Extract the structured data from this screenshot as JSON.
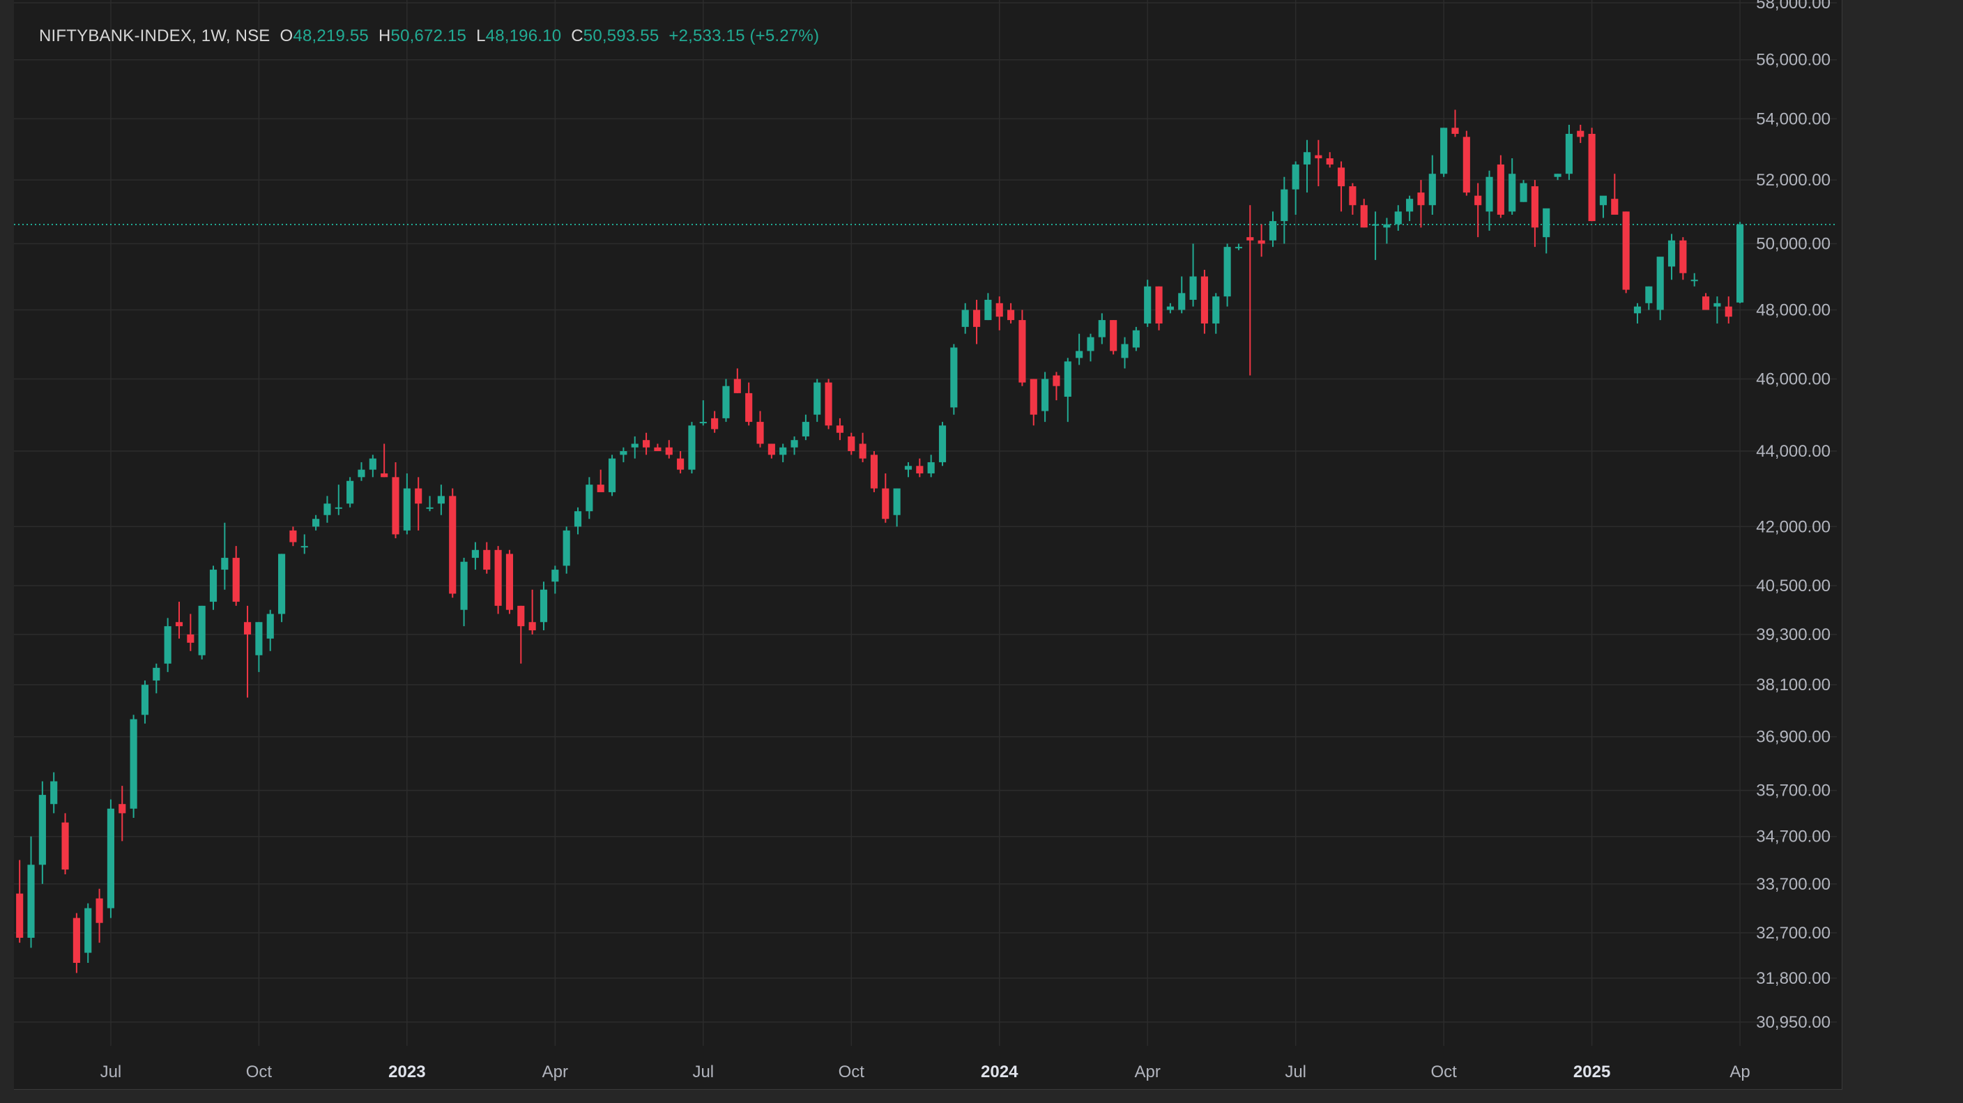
{
  "legend": {
    "symbol": "NIFTYBANK-INDEX, 1W, NSE",
    "o_label": "O",
    "o_value": "48,219.55",
    "h_label": "H",
    "h_value": "50,672.15",
    "l_label": "L",
    "l_value": "48,196.10",
    "c_label": "C",
    "c_value": "50,593.55",
    "change": "+2,533.15 (+5.27%)"
  },
  "colors": {
    "up": "#22ab94",
    "down": "#f23645",
    "grid": "#2c2c2c",
    "text": "#b2b5be",
    "background": "#1c1c1c",
    "last_price_line": "#22ab94"
  },
  "chart_data": {
    "type": "candlestick",
    "interval": "1W",
    "y_axis": {
      "scale": "log",
      "range": [
        30500,
        58100
      ],
      "tick_labels": [
        "58,000.00",
        "56,000.00",
        "54,000.00",
        "52,000.00",
        "50,000.00",
        "48,000.00",
        "46,000.00",
        "44,000.00",
        "42,000.00",
        "40,500.00",
        "39,300.00",
        "38,100.00",
        "36,900.00",
        "35,700.00",
        "34,700.00",
        "33,700.00",
        "32,700.00",
        "31,800.00",
        "30,950.00"
      ],
      "tick_values": [
        58000,
        56000,
        54000,
        52000,
        50000,
        48000,
        46000,
        44000,
        42000,
        40500,
        39300,
        38100,
        36900,
        35700,
        34700,
        33700,
        32700,
        31800,
        30950
      ]
    },
    "x_axis": {
      "tick_labels": [
        "Jul",
        "Oct",
        "2023",
        "Apr",
        "Jul",
        "Oct",
        "2024",
        "Apr",
        "Jul",
        "Oct",
        "2025",
        "Ap"
      ],
      "tick_bold": [
        false,
        false,
        true,
        false,
        false,
        false,
        true,
        false,
        false,
        false,
        true,
        false
      ],
      "tick_bar_index": [
        8,
        21,
        34,
        47,
        60,
        73,
        86,
        99,
        112,
        125,
        138,
        151
      ]
    },
    "grid": true,
    "last_price": 50593.55,
    "candles": [
      [
        33500,
        34200,
        32500,
        32600
      ],
      [
        32600,
        34700,
        32400,
        34100
      ],
      [
        34100,
        35900,
        33700,
        35600
      ],
      [
        35400,
        36100,
        35200,
        35900
      ],
      [
        35000,
        35200,
        33900,
        34000
      ],
      [
        33000,
        33100,
        31900,
        32100
      ],
      [
        32300,
        33300,
        32100,
        33200
      ],
      [
        33400,
        33600,
        32500,
        32900
      ],
      [
        33200,
        35500,
        33000,
        35300
      ],
      [
        35400,
        35800,
        34600,
        35200
      ],
      [
        35300,
        37400,
        35100,
        37300
      ],
      [
        37400,
        38200,
        37200,
        38100
      ],
      [
        38200,
        38600,
        37900,
        38500
      ],
      [
        38600,
        39700,
        38400,
        39500
      ],
      [
        39600,
        40100,
        39200,
        39500
      ],
      [
        39300,
        39800,
        38900,
        39100
      ],
      [
        38800,
        40000,
        38700,
        40000
      ],
      [
        40100,
        41000,
        39900,
        40900
      ],
      [
        40900,
        42100,
        40400,
        41200
      ],
      [
        41200,
        41500,
        40000,
        40100
      ],
      [
        39600,
        40000,
        37800,
        39300
      ],
      [
        38800,
        39600,
        38400,
        39600
      ],
      [
        39200,
        39900,
        38900,
        39800
      ],
      [
        39800,
        41300,
        39600,
        41300
      ],
      [
        41900,
        42000,
        41500,
        41600
      ],
      [
        41500,
        41800,
        41300,
        41500
      ],
      [
        42000,
        42300,
        41900,
        42200
      ],
      [
        42300,
        42800,
        42100,
        42600
      ],
      [
        42500,
        43100,
        42300,
        42500
      ],
      [
        42600,
        43300,
        42500,
        43200
      ],
      [
        43300,
        43700,
        43200,
        43500
      ],
      [
        43500,
        43900,
        43300,
        43800
      ],
      [
        43400,
        44200,
        43300,
        43300
      ],
      [
        43300,
        43700,
        41700,
        41800
      ],
      [
        41900,
        43400,
        41800,
        43000
      ],
      [
        43000,
        43300,
        41900,
        42600
      ],
      [
        42500,
        42800,
        42400,
        42500
      ],
      [
        42600,
        43100,
        42300,
        42800
      ],
      [
        42800,
        43000,
        40200,
        40300
      ],
      [
        39900,
        41200,
        39500,
        41100
      ],
      [
        41200,
        41600,
        40900,
        41400
      ],
      [
        41400,
        41600,
        40800,
        40900
      ],
      [
        41400,
        41500,
        39800,
        40000
      ],
      [
        41300,
        41400,
        39800,
        39900
      ],
      [
        40000,
        40000,
        38600,
        39500
      ],
      [
        39600,
        40400,
        39300,
        39400
      ],
      [
        39600,
        40600,
        39400,
        40400
      ],
      [
        40600,
        41000,
        40300,
        40900
      ],
      [
        41000,
        42000,
        40800,
        41900
      ],
      [
        42000,
        42500,
        41800,
        42400
      ],
      [
        42400,
        43300,
        42200,
        43100
      ],
      [
        43100,
        43500,
        43000,
        42900
      ],
      [
        42900,
        43900,
        42800,
        43800
      ],
      [
        43900,
        44100,
        43700,
        44000
      ],
      [
        44100,
        44400,
        43800,
        44200
      ],
      [
        44300,
        44500,
        43900,
        44100
      ],
      [
        44100,
        44200,
        44000,
        44000
      ],
      [
        44100,
        44300,
        43800,
        43900
      ],
      [
        43800,
        44000,
        43400,
        43500
      ],
      [
        43500,
        44800,
        43400,
        44700
      ],
      [
        44800,
        45400,
        44700,
        44800
      ],
      [
        44900,
        45100,
        44500,
        44600
      ],
      [
        44900,
        46000,
        44800,
        45800
      ],
      [
        46000,
        46300,
        45600,
        45600
      ],
      [
        45600,
        45900,
        44700,
        44800
      ],
      [
        44800,
        45100,
        44100,
        44200
      ],
      [
        44200,
        44200,
        43800,
        43900
      ],
      [
        43900,
        44200,
        43700,
        44100
      ],
      [
        44100,
        44400,
        43900,
        44300
      ],
      [
        44400,
        45000,
        44300,
        44800
      ],
      [
        45000,
        46000,
        44800,
        45900
      ],
      [
        45900,
        46000,
        44600,
        44700
      ],
      [
        44700,
        44900,
        44300,
        44500
      ],
      [
        44400,
        44500,
        43900,
        44000
      ],
      [
        44200,
        44500,
        43700,
        43800
      ],
      [
        43900,
        44000,
        42900,
        43000
      ],
      [
        43000,
        43400,
        42100,
        42200
      ],
      [
        42300,
        43000,
        42000,
        43000
      ],
      [
        43500,
        43700,
        43300,
        43600
      ],
      [
        43600,
        43800,
        43300,
        43400
      ],
      [
        43400,
        43900,
        43300,
        43700
      ],
      [
        43700,
        44800,
        43600,
        44700
      ],
      [
        45200,
        47000,
        45000,
        46900
      ],
      [
        47500,
        48200,
        47300,
        48000
      ],
      [
        48000,
        48300,
        47000,
        47500
      ],
      [
        47700,
        48500,
        47700,
        48300
      ],
      [
        48200,
        48400,
        47400,
        47800
      ],
      [
        48000,
        48200,
        47600,
        47700
      ],
      [
        47700,
        48000,
        45800,
        45900
      ],
      [
        46000,
        46000,
        44700,
        45000
      ],
      [
        45100,
        46200,
        44800,
        46000
      ],
      [
        46100,
        46200,
        45400,
        45800
      ],
      [
        45500,
        46600,
        44800,
        46500
      ],
      [
        46600,
        47300,
        46400,
        46800
      ],
      [
        46800,
        47300,
        46500,
        47200
      ],
      [
        47200,
        47900,
        47000,
        47700
      ],
      [
        47700,
        47700,
        46700,
        46800
      ],
      [
        46600,
        47200,
        46300,
        47000
      ],
      [
        46900,
        47500,
        46800,
        47400
      ],
      [
        47600,
        48900,
        47500,
        48700
      ],
      [
        48700,
        48700,
        47400,
        47600
      ],
      [
        48000,
        48200,
        47900,
        48100
      ],
      [
        48000,
        49000,
        47900,
        48500
      ],
      [
        48300,
        50000,
        48100,
        49000
      ],
      [
        49000,
        49200,
        47300,
        47600
      ],
      [
        47600,
        48500,
        47300,
        48400
      ],
      [
        48400,
        50000,
        48100,
        49900
      ],
      [
        49900,
        50000,
        49800,
        49900
      ],
      [
        50200,
        51200,
        46100,
        50100
      ],
      [
        50100,
        50600,
        49600,
        50000
      ],
      [
        50100,
        51000,
        49900,
        50700
      ],
      [
        50700,
        52100,
        50000,
        51700
      ],
      [
        51700,
        52600,
        50900,
        52500
      ],
      [
        52500,
        53300,
        51600,
        52900
      ],
      [
        52800,
        53300,
        51800,
        52700
      ],
      [
        52700,
        52900,
        52400,
        52500
      ],
      [
        52400,
        52600,
        51000,
        51800
      ],
      [
        51800,
        51900,
        50900,
        51200
      ],
      [
        51200,
        51400,
        50500,
        50500
      ],
      [
        50600,
        51000,
        49500,
        50600
      ],
      [
        50500,
        50800,
        50000,
        50600
      ],
      [
        50600,
        51200,
        50400,
        51000
      ],
      [
        51000,
        51500,
        50700,
        51400
      ],
      [
        51600,
        52000,
        50500,
        51200
      ],
      [
        51200,
        52800,
        50900,
        52200
      ],
      [
        52200,
        53700,
        52100,
        53700
      ],
      [
        53700,
        54300,
        53400,
        53500
      ],
      [
        53400,
        53600,
        51500,
        51600
      ],
      [
        51500,
        51900,
        50200,
        51200
      ],
      [
        51000,
        52300,
        50400,
        52100
      ],
      [
        52500,
        52800,
        50800,
        50900
      ],
      [
        51000,
        52700,
        50900,
        52200
      ],
      [
        51300,
        52000,
        51300,
        51900
      ],
      [
        51800,
        52000,
        49900,
        50500
      ],
      [
        50200,
        51000,
        49700,
        51100
      ],
      [
        52100,
        52200,
        52000,
        52200
      ],
      [
        52200,
        53800,
        52000,
        53500
      ],
      [
        53600,
        53800,
        53200,
        53400
      ],
      [
        53500,
        53700,
        50700,
        50700
      ],
      [
        51200,
        51400,
        50800,
        51500
      ],
      [
        51400,
        52200,
        51100,
        50900
      ],
      [
        51000,
        51000,
        48500,
        48600
      ],
      [
        47900,
        48200,
        47600,
        48100
      ],
      [
        48200,
        48700,
        48000,
        48700
      ],
      [
        48000,
        49500,
        47700,
        49600
      ],
      [
        49300,
        50300,
        48900,
        50100
      ],
      [
        50100,
        50200,
        48900,
        49100
      ],
      [
        48900,
        49100,
        48700,
        48900
      ],
      [
        48400,
        48500,
        48100,
        48000
      ],
      [
        48100,
        48400,
        47600,
        48200
      ],
      [
        48100,
        48400,
        47600,
        47800
      ],
      [
        48219.55,
        50672.15,
        48196.1,
        50593.55
      ]
    ]
  }
}
